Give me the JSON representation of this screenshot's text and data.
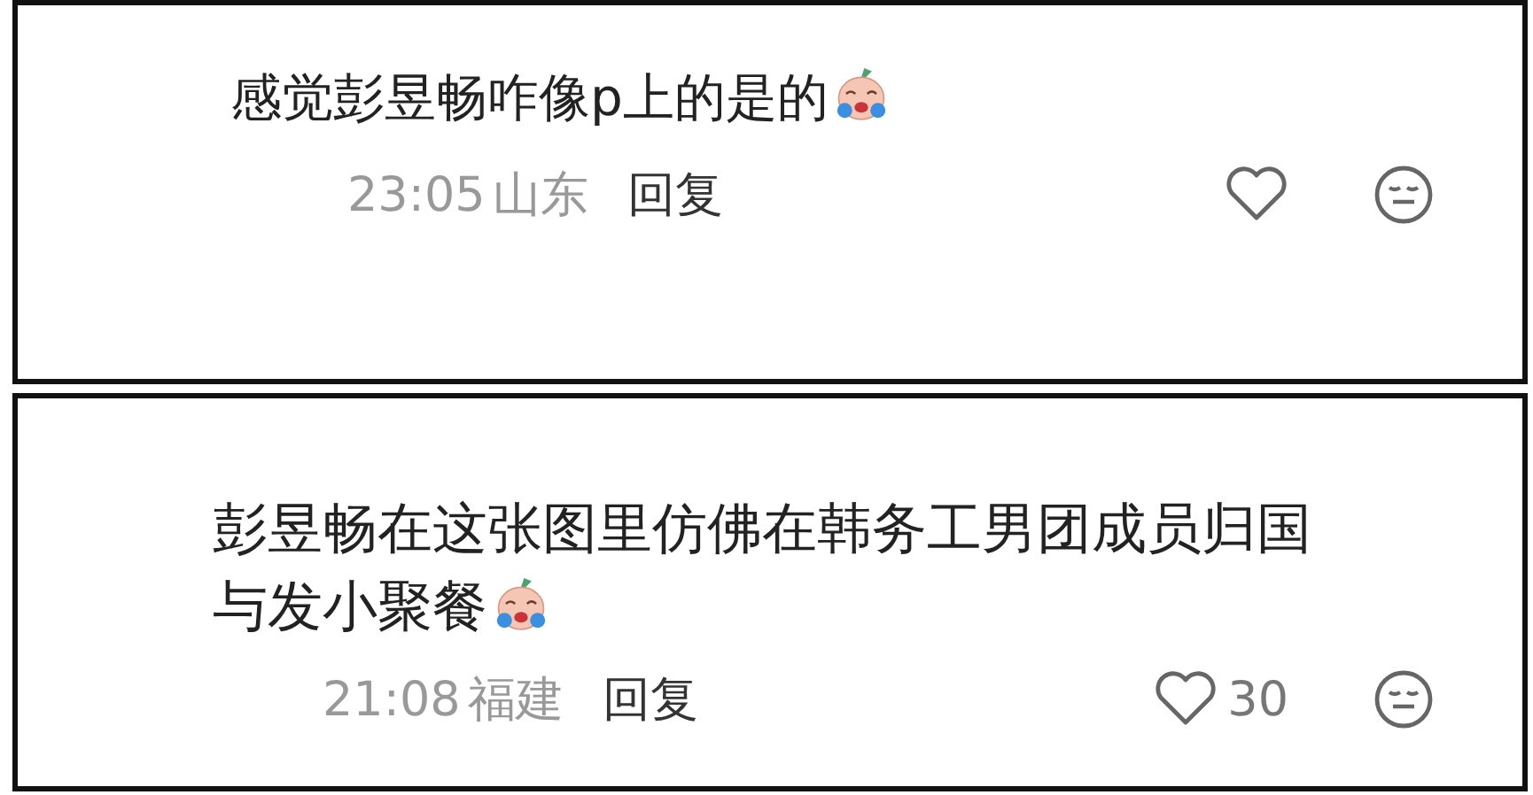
{
  "comments": [
    {
      "text_lines": [
        "感觉彭昱畅咋像p上的是的"
      ],
      "time": "23:05",
      "location": "山东",
      "reply": "回复"
    },
    {
      "text_lines": [
        "彭昱畅在这张图里仿佛在韩务工男团成员归国",
        "与发小聚餐"
      ],
      "time": "21:08",
      "location": "福建",
      "reply": "回复",
      "likes": "30"
    }
  ]
}
